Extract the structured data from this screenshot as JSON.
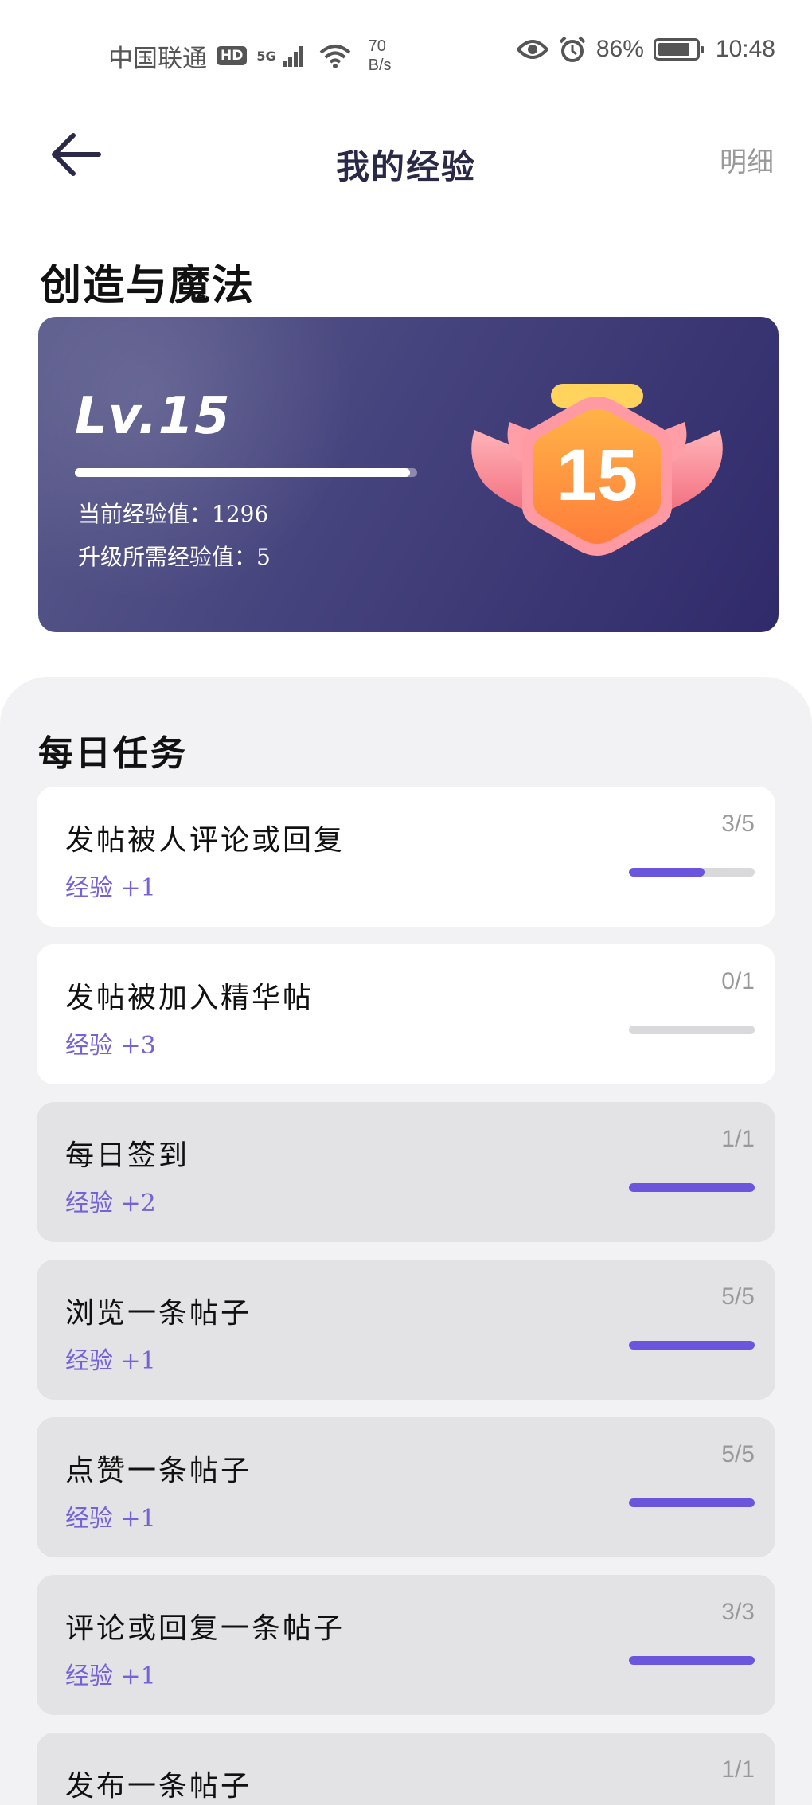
{
  "status_bar": {
    "carrier": "中国联通",
    "hd": "HD",
    "network": "5G",
    "net_speed_value": "70",
    "net_speed_unit": "B/s",
    "battery_percent": "86%",
    "battery_level": 0.86,
    "time": "10:48",
    "icons": [
      "eye-icon",
      "alarm-icon",
      "wifi-icon",
      "signal-icon",
      "battery-icon"
    ]
  },
  "header": {
    "title": "我的经验",
    "details": "明细",
    "back_icon": "back-arrow-icon"
  },
  "game": {
    "name": "创造与魔法"
  },
  "level_card": {
    "level_label": "Lv.15",
    "level_number": "15",
    "progress": 0.98,
    "current_exp_text": "当前经验值：1296",
    "needed_exp_text": "升级所需经验值：5",
    "colors": {
      "card_start": "#5b5b8c",
      "card_end": "#302a6a",
      "badge": "#ff8a3d"
    }
  },
  "daily_tasks": {
    "title": "每日任务",
    "accent_color": "#6a55dc",
    "items": [
      {
        "name": "发帖被人评论或回复",
        "reward": "经验 +1",
        "count": "3/5",
        "progress": 0.6,
        "done": false
      },
      {
        "name": "发帖被加入精华帖",
        "reward": "经验 +3",
        "count": "0/1",
        "progress": 0,
        "done": false
      },
      {
        "name": "每日签到",
        "reward": "经验 +2",
        "count": "1/1",
        "progress": 1,
        "done": true
      },
      {
        "name": "浏览一条帖子",
        "reward": "经验 +1",
        "count": "5/5",
        "progress": 1,
        "done": true
      },
      {
        "name": "点赞一条帖子",
        "reward": "经验 +1",
        "count": "5/5",
        "progress": 1,
        "done": true
      },
      {
        "name": "评论或回复一条帖子",
        "reward": "经验 +1",
        "count": "3/3",
        "progress": 1,
        "done": true
      },
      {
        "name": "发布一条帖子",
        "reward": "",
        "count": "1/1",
        "progress": 1,
        "done": true
      }
    ]
  }
}
